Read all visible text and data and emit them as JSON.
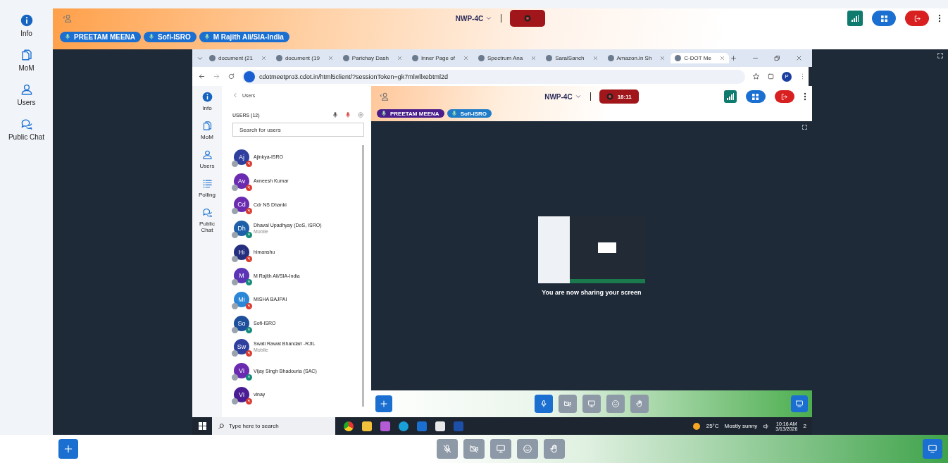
{
  "sidebar": {
    "items": [
      {
        "kind": "info",
        "label": "Info"
      },
      {
        "kind": "mom",
        "label": "MoM"
      },
      {
        "kind": "users",
        "label": "Users"
      },
      {
        "kind": "chat",
        "label": "Public Chat"
      }
    ]
  },
  "top_bar": {
    "room": "NWP-4C",
    "talkers": [
      {
        "name": "PREETAM MEENA",
        "color": "#1a6fd1"
      },
      {
        "name": "Sofi-ISRO",
        "color": "#1a6fd1"
      },
      {
        "name": "M Rajith Ali/SIA-India",
        "color": "#1a6fd1"
      }
    ]
  },
  "browser": {
    "tabs": [
      {
        "title": "document (21",
        "selected": false
      },
      {
        "title": "document (19",
        "selected": false
      },
      {
        "title": "Parichay Dash",
        "selected": false
      },
      {
        "title": "Inner Page of",
        "selected": false
      },
      {
        "title": "Spectrum Ana",
        "selected": false
      },
      {
        "title": "SaralSanch",
        "selected": false
      },
      {
        "title": "Amazon.in Sh",
        "selected": false
      },
      {
        "title": "C-DOT Me",
        "selected": true
      }
    ],
    "url": "cdotmeetpro3.cdot.in/html5client/?sessionToken=gk7mlwllxebtml2d",
    "profile": "P"
  },
  "inner_sidebar": {
    "items": [
      {
        "kind": "info",
        "label": "Info"
      },
      {
        "kind": "mom",
        "label": "MoM"
      },
      {
        "kind": "users",
        "label": "Users"
      },
      {
        "kind": "polling",
        "label": "Polling"
      },
      {
        "kind": "chat",
        "label": "Public Chat"
      }
    ]
  },
  "users_panel": {
    "back_label": "Users",
    "heading": "USERS (12)",
    "search": {
      "placeholder": "Search for users"
    },
    "users": [
      {
        "initials": "Aj",
        "name": "Ajinkya-ISRO",
        "color": "#2f3f9e",
        "muted": true
      },
      {
        "initials": "Av",
        "name": "Avneesh Kumar",
        "color": "#6a2bb0",
        "muted": true
      },
      {
        "initials": "Cd",
        "name": "Cdr NS Dhanki",
        "color": "#6a2bb0",
        "muted": true
      },
      {
        "initials": "Dh",
        "name": "Dhaval Upadhyay (DoS, ISRO)",
        "subtitle": "Mobile",
        "color": "#1d5fa8",
        "muted": false
      },
      {
        "initials": "Hi",
        "name": "himanshu",
        "color": "#24307f",
        "muted": true
      },
      {
        "initials": "M",
        "name": "M Rajith Ali/SIA-India",
        "color": "#5b35b5",
        "muted": false
      },
      {
        "initials": "Mi",
        "name": "MISHA BAJPAI",
        "color": "#2a86d6",
        "muted": true
      },
      {
        "initials": "So",
        "name": "Sofi-ISRO",
        "color": "#1d4f9c",
        "muted": false
      },
      {
        "initials": "Sw",
        "name": "Swati Rawat Bhandari -RJIL",
        "subtitle": "Mobile",
        "color": "#2f3f9e",
        "muted": true
      },
      {
        "initials": "Vi",
        "name": "Vijay Singh Bhadouria (SAC)",
        "color": "#6a2bb0",
        "muted": false
      },
      {
        "initials": "Vi",
        "name": "vinay",
        "color": "#4b1d95",
        "muted": true
      }
    ]
  },
  "meeting": {
    "room": "NWP-4C",
    "timer": "18:11",
    "talkers": [
      {
        "name": "PREETAM MEENA",
        "color": "#4a1f8c"
      },
      {
        "name": "Sofi-ISRO",
        "color": "#1f7bc8"
      }
    ],
    "share_message": "You are now sharing your screen"
  },
  "taskbar": {
    "search_placeholder": "Type here to search",
    "temperature": "25°C",
    "weather": "Mostly sunny",
    "time": "10:16 AM",
    "date": "3/13/2026",
    "notifications": "2"
  }
}
